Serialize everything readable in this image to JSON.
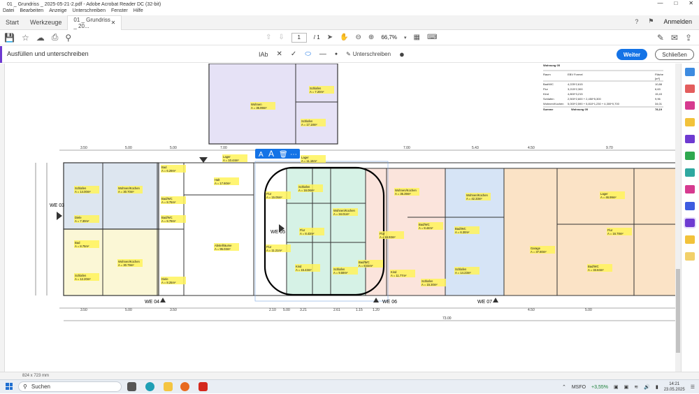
{
  "window": {
    "title": "01 _ Grundriss _ 2025-05-21-2.pdf - Adobe Acrobat Reader DC (32-bit)"
  },
  "menu": [
    "Datei",
    "Bearbeiten",
    "Anzeige",
    "Unterschreiben",
    "Fenster",
    "Hilfe"
  ],
  "tabs": {
    "start": "Start",
    "tools": "Werkzeuge",
    "document": "01 _ Grundriss _ 20...",
    "signin": "Anmelden"
  },
  "toolbar": {
    "page_current": "1",
    "page_total": "/ 1",
    "zoom": "66,7%"
  },
  "fillsign": {
    "label": "Ausfüllen und unterschreiben",
    "sign_label": "Unterschreiben",
    "next_button": "Weiter",
    "close_button": "Schließen",
    "text_tool": "Ab",
    "text_edit_glyphs": [
      "A",
      "A"
    ]
  },
  "floorplan": {
    "units": {
      "we03": "WE 03",
      "we04": "WE 04",
      "we05": "WE 05",
      "we06": "WE 06",
      "we07": "WE 07"
    },
    "dims_top": [
      "3.50",
      "5.00",
      "5.00",
      "7.00",
      "7.00",
      "5.43",
      "4.50",
      "9.70"
    ],
    "dims_bottom": [
      "3.50",
      "5.00",
      "3.50",
      "2.10",
      "5.00",
      "3.21",
      "2.61",
      "1.15",
      "1.20",
      "4.50",
      "5.00"
    ],
    "total_width": "73.00",
    "rooms": [
      {
        "name": "Schlafen",
        "area": "A = 14.00m²"
      },
      {
        "name": "Wohnen/Kochen",
        "area": "A = 30.70m²"
      },
      {
        "name": "Bad",
        "area": "A = 6.29m²"
      },
      {
        "name": "Diele",
        "area": "A = 7.30m²"
      },
      {
        "name": "Bad/WC",
        "area": "A = 8.75m²"
      },
      {
        "name": "Bad/WC",
        "area": "A = 8.79m²"
      },
      {
        "name": "Bad",
        "area": "A = 8.75m²"
      },
      {
        "name": "Wohnen/Kochen",
        "area": "A = 30.79m²"
      },
      {
        "name": "Schlafen",
        "area": "A = 12.20m²"
      },
      {
        "name": "Diele",
        "area": "A = 8.25m²"
      },
      {
        "name": "Lager",
        "area": "A = 10.44m²"
      },
      {
        "name": "Halt",
        "area": "A = 17.60m²"
      },
      {
        "name": "Abstellräume",
        "area": "A = 95.03m²"
      },
      {
        "name": "Flur",
        "area": "A = 15.05m²"
      },
      {
        "name": "Flur",
        "area": "A = 11.21m²"
      },
      {
        "name": "Schlafen",
        "area": "A = 16.06m²"
      },
      {
        "name": "Wohnen/Kochen",
        "area": "A = 34.01m²"
      },
      {
        "name": "Flur",
        "area": "A = 8.43m²"
      },
      {
        "name": "Kind",
        "area": "A = 15.43m²"
      },
      {
        "name": "Schlafen",
        "area": "A = 9.59m²"
      },
      {
        "name": "Bad/WC",
        "area": "A = 8.03m²"
      },
      {
        "name": "Wohnen/Kochen",
        "area": "A = 35.39m²"
      },
      {
        "name": "Flur",
        "area": "A = 16.93m²"
      },
      {
        "name": "Bad/WC",
        "area": "A = 8.44m²"
      },
      {
        "name": "Kind",
        "area": "A = 11.77m²"
      },
      {
        "name": "Schlafen",
        "area": "A = 15.30m²"
      },
      {
        "name": "Wohnen/Kochen",
        "area": "A = 42.33m²"
      },
      {
        "name": "Bad/WC",
        "area": "A = 6.30m²"
      },
      {
        "name": "Schlafen",
        "area": "A = 14.23m²"
      },
      {
        "name": "Lager",
        "area": "A = 46.99m²"
      },
      {
        "name": "Flur",
        "area": "A = 16.78m²"
      },
      {
        "name": "Garage",
        "area": "A = 37.80m²"
      },
      {
        "name": "Bad/WC",
        "area": "A = 33.84m²"
      },
      {
        "name": "Wohnen",
        "area": "A = 36.99m²"
      },
      {
        "name": "Schlafen",
        "area": "A = 7.20m²"
      },
      {
        "name": "Schlafen",
        "area": "A = 17.18m²"
      },
      {
        "name": "Lager",
        "area": "A = 11.16m²"
      }
    ],
    "table": {
      "title": "Wohnung 05",
      "headers": [
        "Raum",
        "EBV Formel",
        "Fläche"
      ],
      "unit": "[m²]",
      "rows": [
        [
          "Bad/WC",
          "4,225*2,615",
          "10,88"
        ],
        [
          "Flur",
          "3,215*2,300",
          "6,63"
        ],
        [
          "Kind",
          "4,800*3,215",
          "15,43"
        ],
        [
          "Schlafen",
          "2,500*2,600 + 2,450*5,300",
          "9,96"
        ],
        [
          "Wohnen/Kochen",
          "5,000*2,590 + 5,810*1,230 + 4,300*0,700",
          "34,01"
        ]
      ],
      "sum_label": "Summe",
      "sum_formula": "Wohnung 05",
      "sum_value": "78,19"
    }
  },
  "status": {
    "page_size": "824 x 723 mm"
  },
  "taskbar": {
    "search": "Suchen",
    "stock": "MSFO",
    "stock_change": "+3,55%",
    "time": "14:21",
    "date": "23.05.2025"
  }
}
